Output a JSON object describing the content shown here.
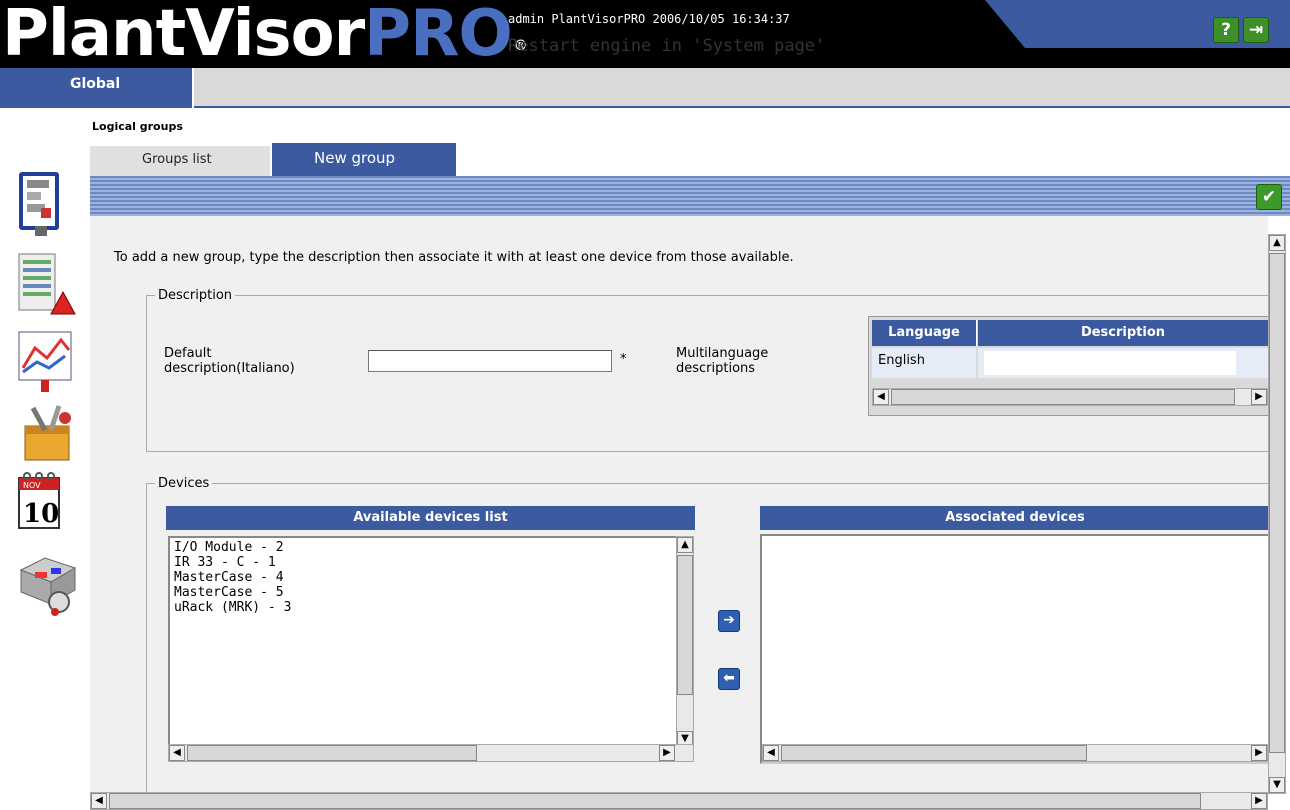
{
  "header": {
    "logo_main": "PlantVisor",
    "logo_accent": "PRO",
    "logo_reg": "®",
    "user_info": "admin  PlantVisorPRO  2006/10/05  16:34:37",
    "status_message": "Restart engine in 'System page'",
    "help_label": "?",
    "logout_label": "⇥"
  },
  "nav": {
    "global_tab": "Global"
  },
  "page": {
    "title": "Logical groups",
    "tabs": [
      {
        "label": "Groups list",
        "active": false
      },
      {
        "label": "New group",
        "active": true
      }
    ],
    "confirm_label": "✔",
    "intro": "To add a new group, type the description then associate it with at least one device from those available."
  },
  "description_section": {
    "legend": "Description",
    "default_label_line1": "Default",
    "default_label_line2": "description(Italiano)",
    "default_value": "",
    "required_mark": "*",
    "multilang_label_line1": "Multilanguage",
    "multilang_label_line2": "descriptions",
    "table": {
      "columns": [
        "Language",
        "Description"
      ],
      "rows": [
        {
          "language": "English",
          "description": ""
        }
      ]
    }
  },
  "devices_section": {
    "legend": "Devices",
    "available_header": "Available devices list",
    "associated_header": "Associated devices",
    "available": [
      "I/O Module - 2",
      "IR 33 - C - 1",
      "MasterCase - 4",
      "MasterCase - 5",
      "uRack (MRK) - 3"
    ],
    "associated": [],
    "add_label": "➔",
    "remove_label": "⬅"
  },
  "sidebar": {
    "items": [
      {
        "icon": "groups-icon",
        "selected": true
      },
      {
        "icon": "alarms-report-icon"
      },
      {
        "icon": "graph-icon"
      },
      {
        "icon": "tools-icon"
      },
      {
        "icon": "calendar-icon",
        "month": "NOV",
        "day": "10"
      },
      {
        "icon": "site-map-icon"
      }
    ]
  },
  "colors": {
    "brand_blue": "#3b5aa0",
    "header_black": "#000000",
    "ok_green": "#3d9a2a"
  }
}
